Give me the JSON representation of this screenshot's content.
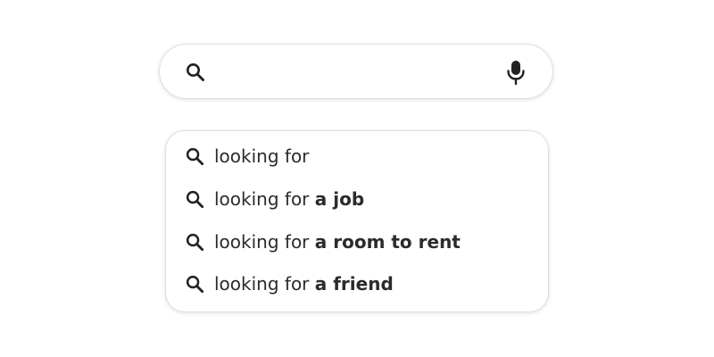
{
  "search": {
    "value": "",
    "placeholder": "",
    "search_icon": "search-icon",
    "mic_icon": "microphone-icon"
  },
  "suggestions": [
    {
      "prefix": "looking for",
      "completion": ""
    },
    {
      "prefix": "looking for",
      "completion": "a job"
    },
    {
      "prefix": "looking for",
      "completion": "a room to rent"
    },
    {
      "prefix": "looking for",
      "completion": "a friend"
    }
  ],
  "colors": {
    "text": "#2b2b2b",
    "border": "#dedede",
    "icon": "#222222"
  }
}
